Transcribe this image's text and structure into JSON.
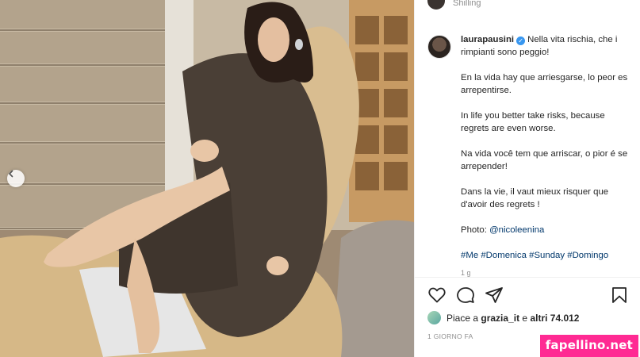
{
  "previous_comment": {
    "text": "Shilling"
  },
  "post": {
    "username": "laurapausini",
    "verified": true,
    "caption_lines": [
      "Nella vita rischia, che i rimpianti sono peggio!",
      "En la vida hay que arriesgarse, lo peor es arrepentirse.",
      "In life you better take risks, because regrets are even worse.",
      "Na vida você tem que arriscar, o pior é se arrepender!",
      "Dans la vie, il vaut mieux risquer que d'avoir des regrets !"
    ],
    "photo_credit_label": "Photo:",
    "photo_credit_handle": "@nicoleenina",
    "hashtags": "#Me #Domenica #Sunday #Domingo",
    "truncated_line": "1 g"
  },
  "likes": {
    "prefix": "Piace a",
    "user": "grazia_it",
    "middle": "e",
    "others": "altri 74.012"
  },
  "timestamp": "1 GIORNO FA",
  "icons": {
    "like": "heart-icon",
    "comment": "comment-icon",
    "share": "share-icon",
    "save": "bookmark-icon",
    "prev": "chevron-left-icon",
    "verified": "verified-badge-icon"
  },
  "watermark": "fapellino.net",
  "colors": {
    "link": "#00376b",
    "verified": "#3897f0",
    "muted": "#8e8e8e",
    "watermark_bg": "#ff2a93"
  }
}
